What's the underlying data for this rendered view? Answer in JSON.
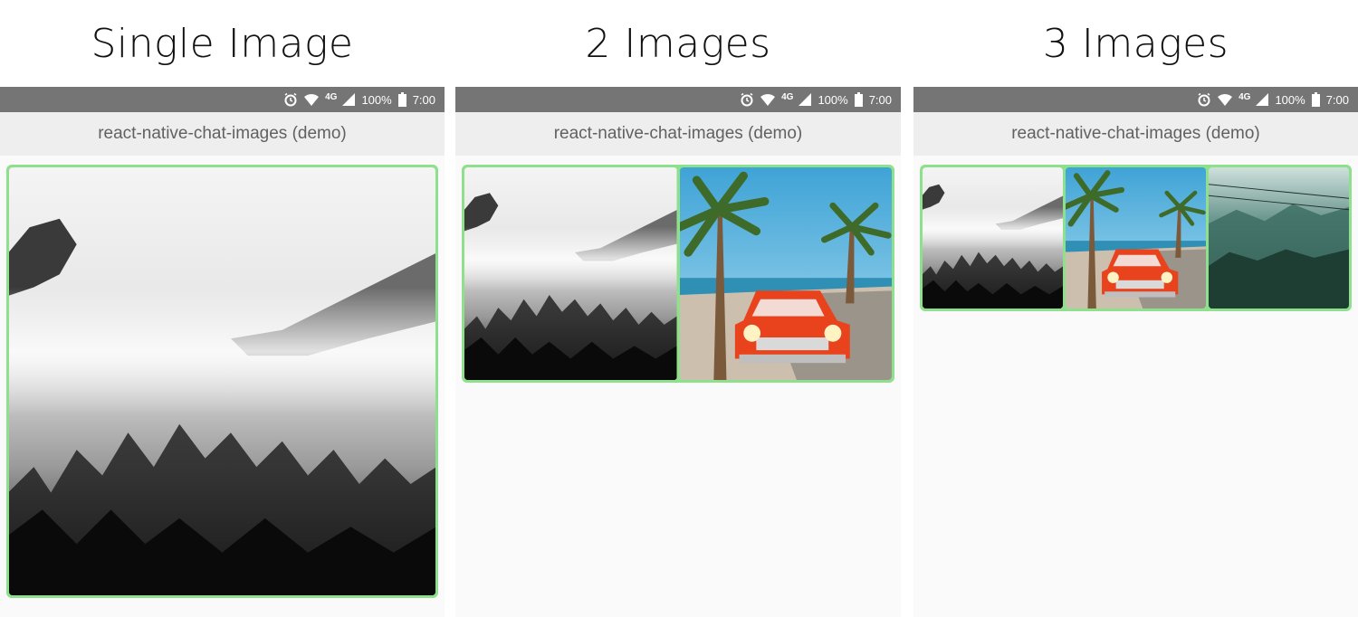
{
  "panels": [
    {
      "heading": "Single Image",
      "status": {
        "network": "4G",
        "battery": "100%",
        "time": "7:00"
      },
      "toolbar_title": "react-native-chat-images (demo)",
      "images": [
        "foggy-forest"
      ]
    },
    {
      "heading": "2 Images",
      "status": {
        "network": "4G",
        "battery": "100%",
        "time": "7:00"
      },
      "toolbar_title": "react-native-chat-images (demo)",
      "images": [
        "foggy-forest",
        "red-car-palms"
      ]
    },
    {
      "heading": "3 Images",
      "status": {
        "network": "4G",
        "battery": "100%",
        "time": "7:00"
      },
      "toolbar_title": "react-native-chat-images (demo)",
      "images": [
        "foggy-forest",
        "red-car-palms",
        "green-mountains"
      ]
    }
  ],
  "colors": {
    "border": "#8fe08c",
    "statusbar": "#757575",
    "toolbar": "#eeeeee"
  },
  "icons": [
    "alarm-icon",
    "wifi-icon",
    "signal-icon",
    "battery-icon"
  ]
}
